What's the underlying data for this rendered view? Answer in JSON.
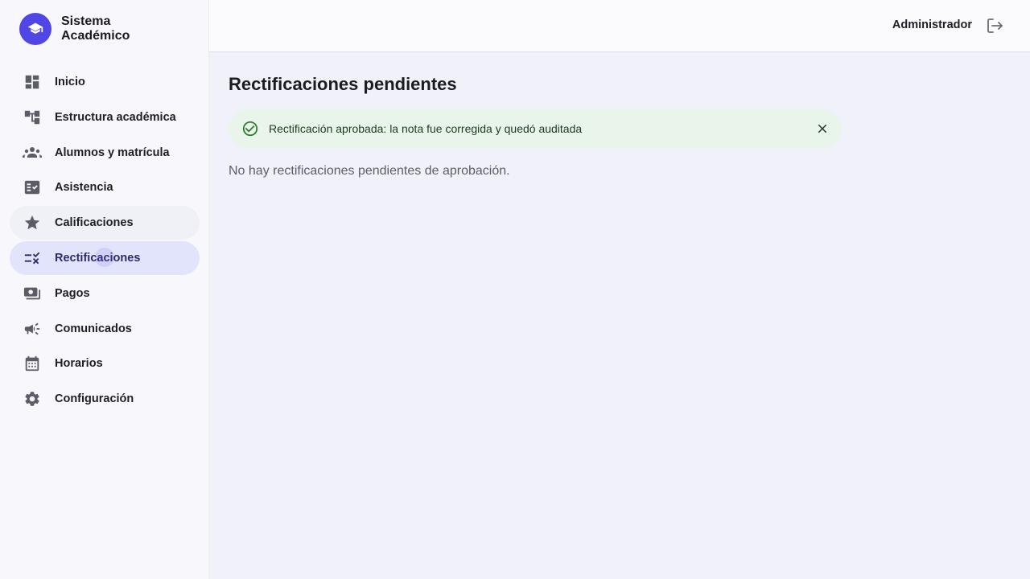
{
  "brand": {
    "line1": "Sistema",
    "line2": "Académico",
    "logo_icon": "graduation-cap-icon",
    "color": "#4f46e5"
  },
  "sidebar": {
    "items": [
      {
        "label": "Inicio",
        "icon": "dashboard-icon"
      },
      {
        "label": "Estructura académica",
        "icon": "account-tree-icon"
      },
      {
        "label": "Alumnos y matrícula",
        "icon": "groups-icon"
      },
      {
        "label": "Asistencia",
        "icon": "fact-check-icon"
      },
      {
        "label": "Calificaciones",
        "icon": "star-icon",
        "state": "hover"
      },
      {
        "label": "Rectificaciones",
        "icon": "rule-icon",
        "state": "active"
      },
      {
        "label": "Pagos",
        "icon": "payments-icon"
      },
      {
        "label": "Comunicados",
        "icon": "campaign-icon"
      },
      {
        "label": "Horarios",
        "icon": "calendar-icon"
      },
      {
        "label": "Configuración",
        "icon": "settings-icon"
      }
    ]
  },
  "header": {
    "user": "Administrador",
    "logout_icon": "logout-icon"
  },
  "main": {
    "title": "Rectificaciones pendientes",
    "alert": {
      "message": "Rectificación aprobada: la nota fue corregida y quedó auditada",
      "icon": "check-circle-icon",
      "close_icon": "close-icon",
      "color": "#2e7d32"
    },
    "empty_message": "No hay rectificaciones pendientes de aprobación."
  }
}
